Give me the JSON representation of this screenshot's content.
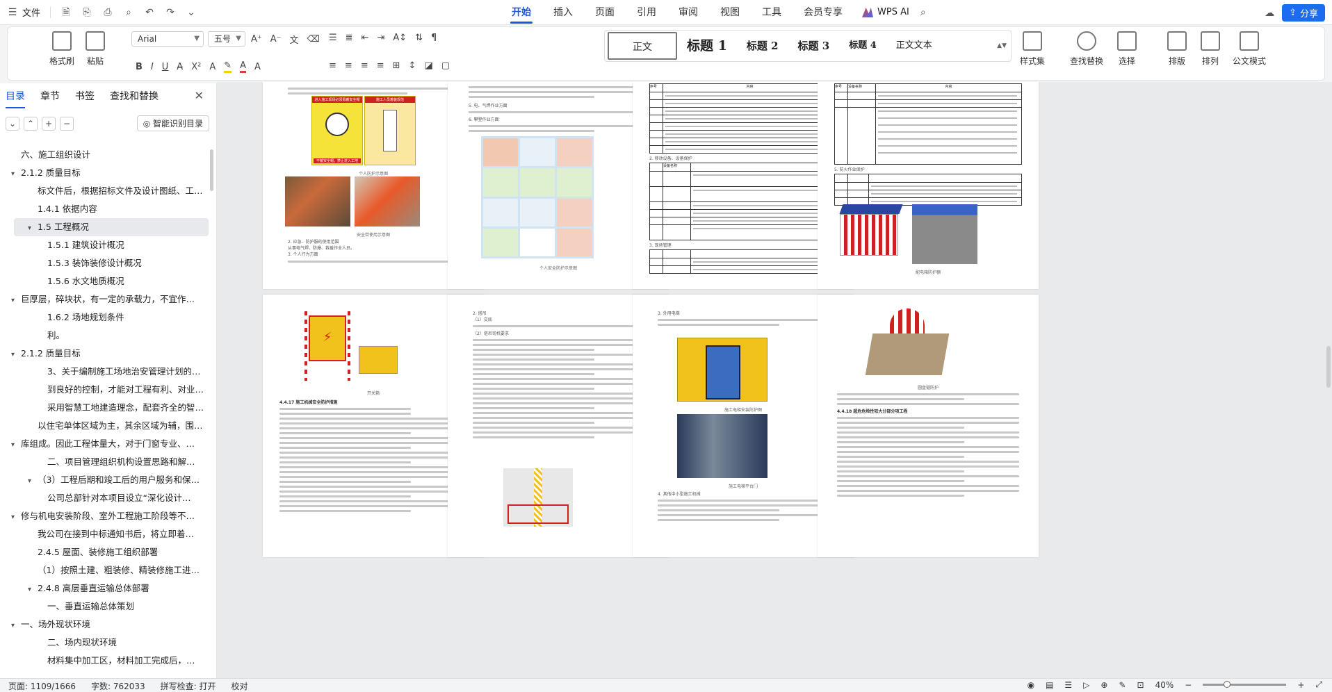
{
  "titlebar": {
    "file_menu": "文件",
    "tabs": [
      "开始",
      "插入",
      "页面",
      "引用",
      "审阅",
      "视图",
      "工具",
      "会员专享"
    ],
    "active_tab": "开始",
    "wps_ai": "WPS AI",
    "share": "分享"
  },
  "ribbon": {
    "format_painter": "格式刷",
    "paste": "粘贴",
    "font_name": "Arial",
    "font_size": "五号",
    "styles": [
      "正文",
      "标题 1",
      "标题 2",
      "标题 3",
      "标题 4",
      "正文文本"
    ],
    "style_set": "样式集",
    "find_replace": "查找替换",
    "select": "选择",
    "layout": "排版",
    "arrange": "排列",
    "doc_mode": "公文模式"
  },
  "sidebar": {
    "tabs": [
      "目录",
      "章节",
      "书签",
      "查找和替换"
    ],
    "smart_toc": "智能识别目录",
    "toc": [
      {
        "level": 1,
        "text": "六、施工组织设计",
        "tw": ""
      },
      {
        "level": 1,
        "text": "2.1.2 质量目标",
        "tw": "▾"
      },
      {
        "level": 2,
        "text": "标文件后，根据招标文件及设计图纸、工程…",
        "tw": ""
      },
      {
        "level": 2,
        "text": "1.4.1 依据内容",
        "tw": ""
      },
      {
        "level": 2,
        "text": "1.5 工程概况",
        "tw": "▾",
        "sel": true
      },
      {
        "level": 3,
        "text": "1.5.1 建筑设计概况",
        "tw": ""
      },
      {
        "level": 3,
        "text": "1.5.3 装饰装修设计概况",
        "tw": ""
      },
      {
        "level": 3,
        "text": "1.5.6 水文地质概况",
        "tw": ""
      },
      {
        "level": 1,
        "text": "巨厚层，碎块状，有一定的承载力，不宜作…",
        "tw": "▾"
      },
      {
        "level": 3,
        "text": "1.6.2 场地规划条件",
        "tw": ""
      },
      {
        "level": 3,
        "text": "利。",
        "tw": ""
      },
      {
        "level": 1,
        "text": "2.1.2 质量目标",
        "tw": "▾"
      },
      {
        "level": 3,
        "text": "3、关于编制施工场地治安管理计划的约…",
        "tw": ""
      },
      {
        "level": 3,
        "text": "到良好的控制，才能对工程有利、对业…",
        "tw": ""
      },
      {
        "level": 3,
        "text": "采用智慧工地建造理念，配套齐全的智…",
        "tw": ""
      },
      {
        "level": 2,
        "text": "以住宅单体区域为主，其余区域为辅，围绕…",
        "tw": ""
      },
      {
        "level": 1,
        "text": "库组成。因此工程体量大，对于门窗专业、…",
        "tw": "▾"
      },
      {
        "level": 3,
        "text": "二、项目管理组织机构设置思路和解…",
        "tw": ""
      },
      {
        "level": 2,
        "text": "（3）工程后期和竣工后的用户服务和保…",
        "tw": "▾"
      },
      {
        "level": 3,
        "text": "公司总部针对本项目设立“深化设计…",
        "tw": ""
      },
      {
        "level": 1,
        "text": "修与机电安装阶段、室外工程施工阶段等不…",
        "tw": "▾"
      },
      {
        "level": 2,
        "text": "我公司在接到中标通知书后，将立即着…",
        "tw": ""
      },
      {
        "level": 2,
        "text": "2.4.5 屋面、装修施工组织部署",
        "tw": ""
      },
      {
        "level": 2,
        "text": "（1）按照土建、粗装修、精装修施工进…",
        "tw": ""
      },
      {
        "level": 2,
        "text": "2.4.8 高层垂直运输总体部署",
        "tw": "▾"
      },
      {
        "level": 3,
        "text": "一、垂直运输总体策划",
        "tw": ""
      },
      {
        "level": 1,
        "text": "一、场外现状环境",
        "tw": "▾"
      },
      {
        "level": 3,
        "text": "二、场内现状环境",
        "tw": ""
      },
      {
        "level": 3,
        "text": "材料集中加工区，材料加工完成后，…",
        "tw": ""
      }
    ]
  },
  "pages": {
    "p1": {
      "poster_left_title": "进入施工现场必须佩戴安全帽",
      "poster_left_footer": "不戴安全帽，禁止进入工地",
      "poster_right_title": "施工人员着装规范",
      "cap1": "个人防护示意图",
      "cap2": "安全带使用示意图",
      "line1": "2. 应急、防护服的使用范围",
      "line2": "从事电气焊、防爆、救援作业人员。",
      "line3": "3. 个人行为方面"
    },
    "p2": {
      "head1": "5. 电、气焊作业方面",
      "head2": "6. 攀登作业方面",
      "cap": "个人安全防护示意图"
    },
    "p3": {
      "hdr1": "序号",
      "hdr2": "内容",
      "s2": "2. 移动设备、设备保护",
      "s3": "3. 现场管理",
      "hdr3": "设备名称"
    },
    "p4": {
      "hdr1": "序号",
      "hdr2": "设备名称",
      "hdr3": "内容",
      "s5": "5. 防火作业保护",
      "cap": "配电箱防护棚"
    },
    "p5": {
      "cap1": "开关箱",
      "heading": "4.4.17 施工机械安全防护措施"
    },
    "p6": {
      "l1": "2. 塔吊",
      "l2": "（1）交底",
      "l3": "（2）塔吊司机要求"
    },
    "p7": {
      "l1": "3. 外用电梯",
      "cap1": "施工电梯安装防护图",
      "cap2": "施工电梯平台门",
      "l2": "4. 其他中小型施工机械"
    },
    "p8": {
      "cap": "圆盘锯防护",
      "heading": "4.4.18 超危危险性较大分部分项工程"
    }
  },
  "status": {
    "page": "页面: 1109/1666",
    "words": "字数: 762033",
    "spell": "拼写检查: 打开",
    "proof": "校对",
    "zoom": "40%"
  }
}
